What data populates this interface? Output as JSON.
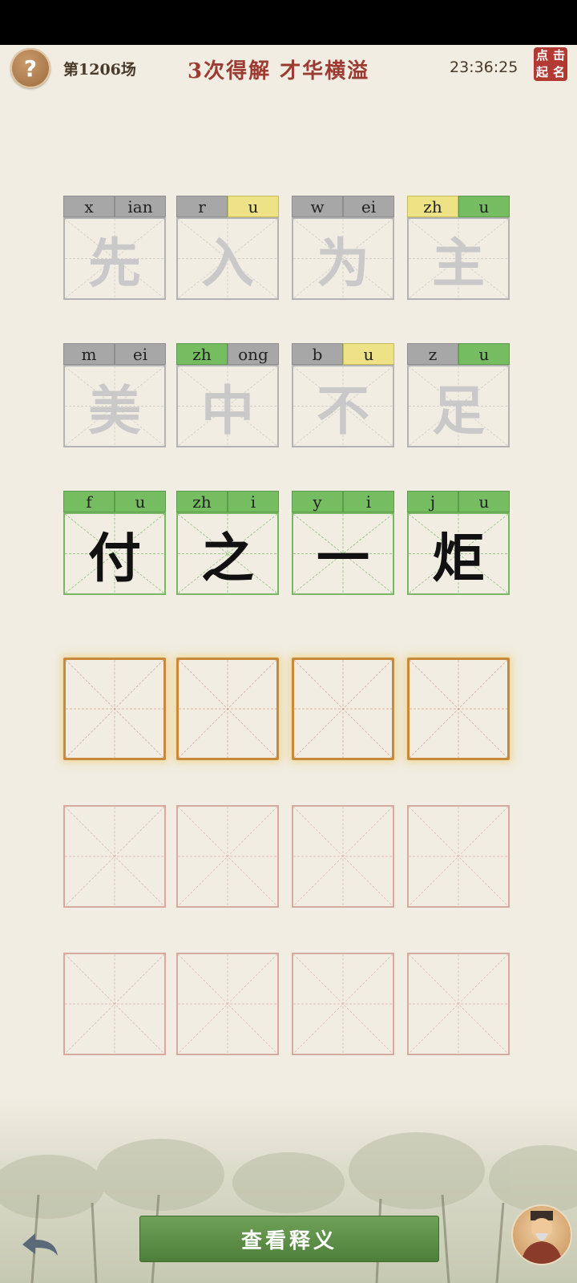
{
  "header": {
    "help_icon": "question-mark-icon",
    "help_glyph": "?",
    "round_label": "第1206场",
    "result_title": "3次得解 才华横溢",
    "clock": "23:36:25",
    "seal_chars": [
      "点",
      "击",
      "起",
      "名"
    ]
  },
  "colors": {
    "gray": "#a7a7a7",
    "yellow": "#eee287",
    "green": "#76bd61",
    "title_red": "#9c3b32",
    "active_orange": "#c8893a"
  },
  "guesses": [
    {
      "state": "attempt",
      "cells": [
        {
          "char": "先",
          "pinyin": [
            {
              "text": "x",
              "status": "gray"
            },
            {
              "text": "ian",
              "status": "gray"
            }
          ]
        },
        {
          "char": "入",
          "pinyin": [
            {
              "text": "r",
              "status": "gray"
            },
            {
              "text": "u",
              "status": "yellow"
            }
          ]
        },
        {
          "char": "为",
          "pinyin": [
            {
              "text": "w",
              "status": "gray"
            },
            {
              "text": "ei",
              "status": "gray"
            }
          ]
        },
        {
          "char": "主",
          "pinyin": [
            {
              "text": "zh",
              "status": "yellow"
            },
            {
              "text": "u",
              "status": "green"
            }
          ]
        }
      ]
    },
    {
      "state": "attempt",
      "cells": [
        {
          "char": "美",
          "pinyin": [
            {
              "text": "m",
              "status": "gray"
            },
            {
              "text": "ei",
              "status": "gray"
            }
          ]
        },
        {
          "char": "中",
          "pinyin": [
            {
              "text": "zh",
              "status": "green"
            },
            {
              "text": "ong",
              "status": "gray"
            }
          ]
        },
        {
          "char": "不",
          "pinyin": [
            {
              "text": "b",
              "status": "gray"
            },
            {
              "text": "u",
              "status": "yellow"
            }
          ]
        },
        {
          "char": "足",
          "pinyin": [
            {
              "text": "z",
              "status": "gray"
            },
            {
              "text": "u",
              "status": "green"
            }
          ]
        }
      ]
    },
    {
      "state": "solved",
      "cells": [
        {
          "char": "付",
          "pinyin": [
            {
              "text": "f",
              "status": "green"
            },
            {
              "text": "u",
              "status": "green"
            }
          ]
        },
        {
          "char": "之",
          "pinyin": [
            {
              "text": "zh",
              "status": "green"
            },
            {
              "text": "i",
              "status": "green"
            }
          ]
        },
        {
          "char": "一",
          "pinyin": [
            {
              "text": "y",
              "status": "green"
            },
            {
              "text": "i",
              "status": "green"
            }
          ]
        },
        {
          "char": "炬",
          "pinyin": [
            {
              "text": "j",
              "status": "green"
            },
            {
              "text": "u",
              "status": "green"
            }
          ]
        }
      ]
    },
    {
      "state": "active",
      "cells": [
        {},
        {},
        {},
        {}
      ]
    },
    {
      "state": "empty",
      "cells": [
        {},
        {},
        {},
        {}
      ]
    },
    {
      "state": "empty",
      "cells": [
        {},
        {},
        {},
        {}
      ]
    }
  ],
  "footer": {
    "back_icon": "back-arrow-icon",
    "explain_label": "查看释义",
    "avatar_icon": "scholar-avatar-icon"
  }
}
